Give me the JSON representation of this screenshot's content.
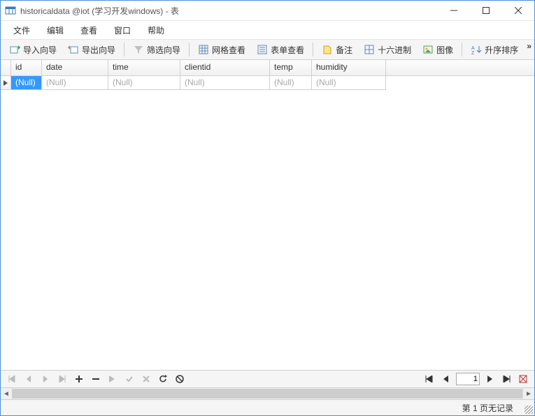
{
  "window": {
    "title": "historicaldata @iot (学习开发windows) - 表"
  },
  "menu": {
    "items": [
      "文件",
      "编辑",
      "查看",
      "窗口",
      "帮助"
    ]
  },
  "toolbar": {
    "import_label": "导入向导",
    "export_label": "导出向导",
    "filter_label": "筛选向导",
    "gridview_label": "网格查看",
    "formview_label": "表单查看",
    "memo_label": "备注",
    "hex_label": "十六进制",
    "image_label": "图像",
    "sortasc_label": "升序排序"
  },
  "columns": [
    "id",
    "date",
    "time",
    "clientid",
    "temp",
    "humidity"
  ],
  "rows": [
    {
      "id": "(Null)",
      "date": "(Null)",
      "time": "(Null)",
      "clientid": "(Null)",
      "temp": "(Null)",
      "humidity": "(Null)"
    }
  ],
  "null_text": "(Null)",
  "pager": {
    "current": "1"
  },
  "status": {
    "text": "第 1 页无记录"
  }
}
